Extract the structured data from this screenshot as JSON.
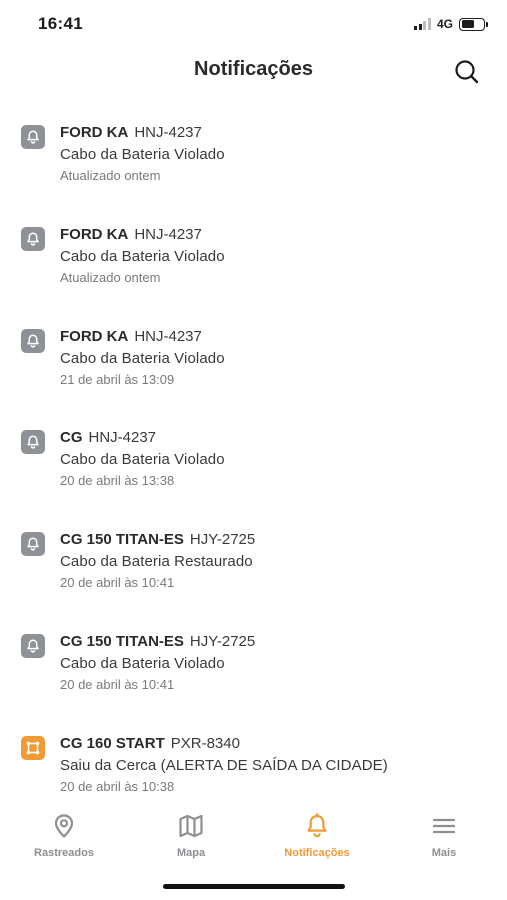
{
  "status_bar": {
    "time": "16:41",
    "network": "4G",
    "battery_level": 0.6
  },
  "header": {
    "title": "Notificações",
    "search_icon": "search-icon"
  },
  "notifications": [
    {
      "icon": "bell-icon",
      "icon_color": "#8e9296",
      "vehicle": "FORD KA",
      "plate": "HNJ-4237",
      "message": "Cabo da Bateria Violado",
      "time": "Atualizado ontem"
    },
    {
      "icon": "bell-icon",
      "icon_color": "#8e9296",
      "vehicle": "FORD KA",
      "plate": "HNJ-4237",
      "message": "Cabo da Bateria Violado",
      "time": "Atualizado ontem"
    },
    {
      "icon": "bell-icon",
      "icon_color": "#8e9296",
      "vehicle": "FORD KA",
      "plate": "HNJ-4237",
      "message": "Cabo da Bateria Violado",
      "time": "21 de abril às 13:09"
    },
    {
      "icon": "bell-icon",
      "icon_color": "#8e9296",
      "vehicle": "CG",
      "plate": "HNJ-4237",
      "message": "Cabo da Bateria Violado",
      "time": "20 de abril às 13:38"
    },
    {
      "icon": "bell-icon",
      "icon_color": "#8e9296",
      "vehicle": "CG 150 TITAN-ES",
      "plate": "HJY-2725",
      "message": "Cabo da Bateria Restaurado",
      "time": "20 de abril às 10:41"
    },
    {
      "icon": "bell-icon",
      "icon_color": "#8e9296",
      "vehicle": "CG 150 TITAN-ES",
      "plate": "HJY-2725",
      "message": "Cabo da Bateria Violado",
      "time": "20 de abril às 10:41"
    },
    {
      "icon": "geofence-icon",
      "icon_color": "#f09a38",
      "vehicle": "CG 160 START",
      "plate": "PXR-8340",
      "message": "Saiu da Cerca (ALERTA DE SAÍDA DA CIDADE)",
      "time": "20 de abril às 10:38"
    }
  ],
  "tabs": [
    {
      "label": "Rastreados",
      "icon": "location-pin-icon",
      "active": false
    },
    {
      "label": "Mapa",
      "icon": "map-icon",
      "active": false
    },
    {
      "label": "Notificações",
      "icon": "bell-icon",
      "active": true
    },
    {
      "label": "Mais",
      "icon": "menu-icon",
      "active": false
    }
  ],
  "colors": {
    "accent": "#f09a38",
    "inactive": "#8e8e93",
    "alert_gray": "#8e9296"
  }
}
